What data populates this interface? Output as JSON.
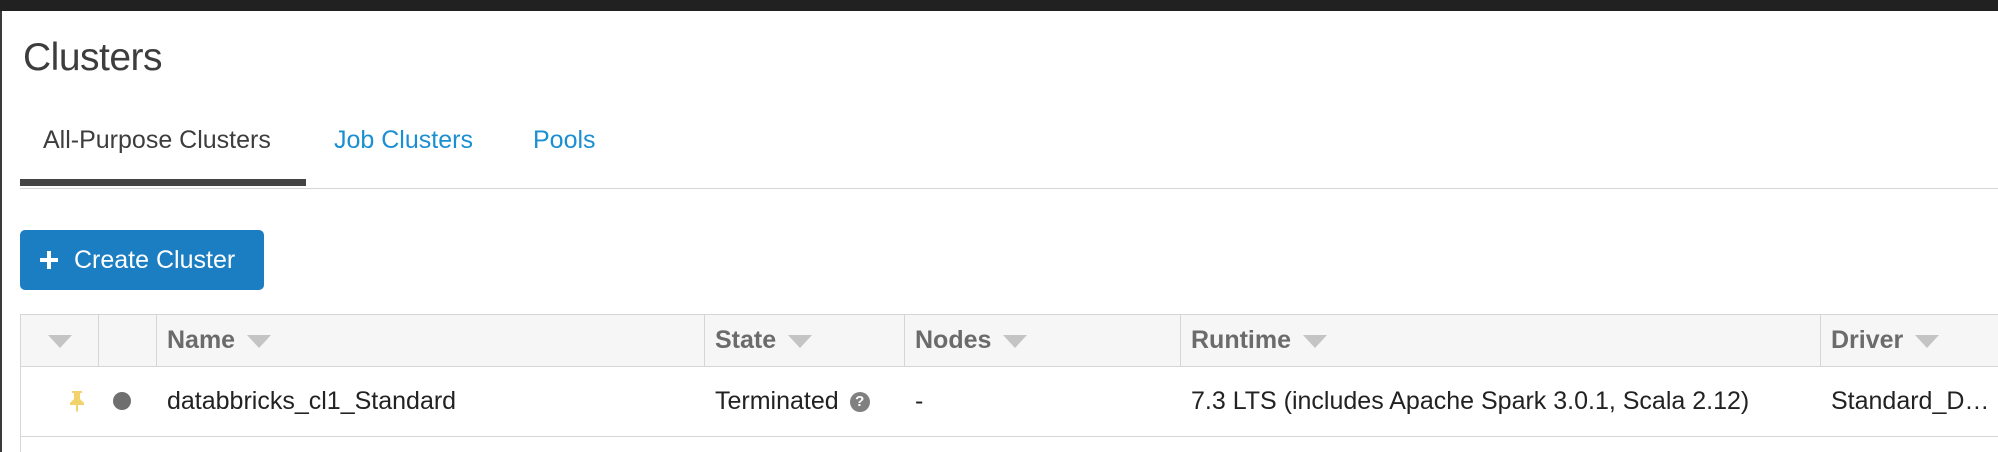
{
  "page": {
    "title": "Clusters"
  },
  "tabs": [
    {
      "label": "All-Purpose Clusters",
      "active": true
    },
    {
      "label": "Job Clusters",
      "active": false
    },
    {
      "label": "Pools",
      "active": false
    }
  ],
  "toolbar": {
    "create_label": "Create Cluster",
    "create_icon": "plus-icon"
  },
  "table": {
    "columns": [
      "Name",
      "State",
      "Nodes",
      "Runtime",
      "Driver"
    ],
    "rows": [
      {
        "pinned": true,
        "status_color": "#6f6f6f",
        "name": "databbricks_cl1_Standard",
        "state": "Terminated",
        "nodes": "-",
        "runtime": "7.3 LTS (includes Apache Spark 3.0.1, Scala 2.12)",
        "driver": "Standard_D…"
      }
    ]
  },
  "colors": {
    "accent": "#1b7ec2",
    "link": "#1a8fd1",
    "pin": "#f2d26b",
    "top_bar": "#212121"
  }
}
